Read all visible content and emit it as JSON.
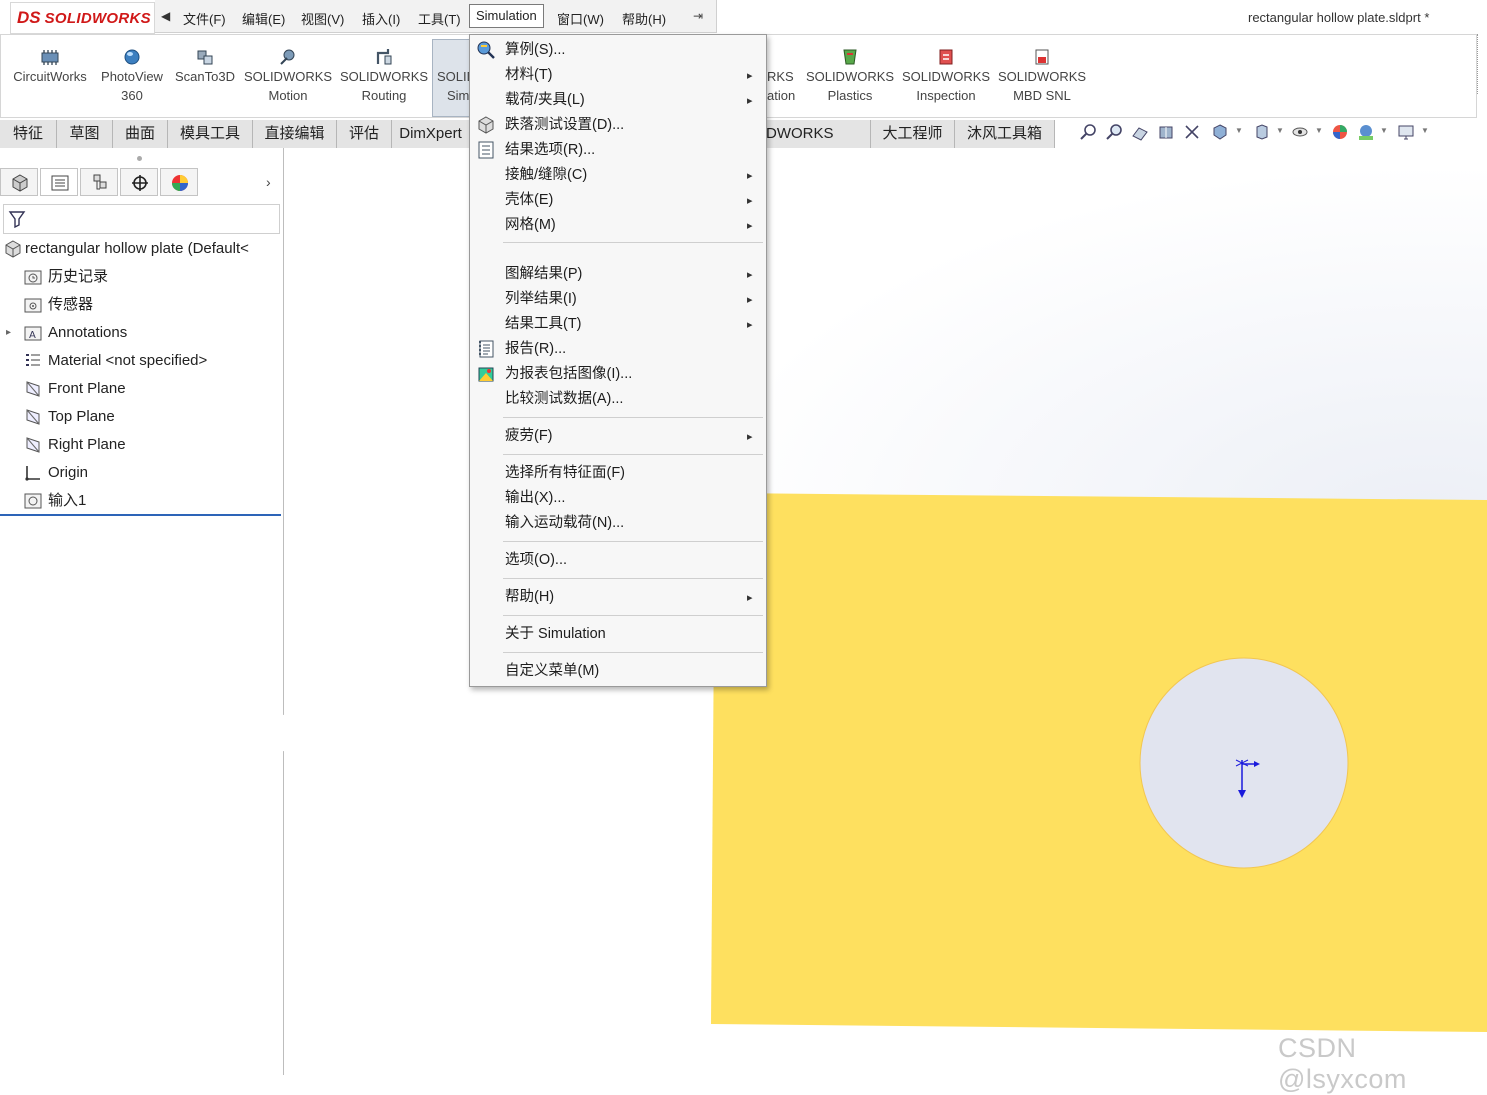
{
  "titlebar": {
    "logo_ds": "DS",
    "logo_text": "SOLIDWORKS",
    "menu": [
      "文件(F)",
      "编辑(E)",
      "视图(V)",
      "插入(I)",
      "工具(T)",
      "Simulation",
      "窗口(W)",
      "帮助(H)"
    ],
    "document_title": "rectangular hollow plate.sldprt *"
  },
  "command_manager": [
    {
      "line1": "CircuitWorks",
      "line2": "",
      "icon": "circuitworks-icon"
    },
    {
      "line1": "PhotoView",
      "line2": "360",
      "icon": "photoview-icon"
    },
    {
      "line1": "ScanTo3D",
      "line2": "",
      "icon": "scanto3d-icon"
    },
    {
      "line1": "SOLIDWORKS",
      "line2": "Motion",
      "icon": "motion-icon"
    },
    {
      "line1": "SOLIDWORKS",
      "line2": "Routing",
      "icon": "routing-icon"
    },
    {
      "line1": "SOLID",
      "line2": "Sim",
      "icon": "simulation-icon"
    },
    {
      "line1": "RKS",
      "line2": "ation",
      "icon": ""
    },
    {
      "line1": "SOLIDWORKS",
      "line2": "Plastics",
      "icon": "plastics-icon"
    },
    {
      "line1": "SOLIDWORKS",
      "line2": "Inspection",
      "icon": "inspection-icon"
    },
    {
      "line1": "SOLIDWORKS",
      "line2": "MBD SNL",
      "icon": "mbd-snl-icon"
    }
  ],
  "tabs": [
    "特征",
    "草图",
    "曲面",
    "模具工具",
    "直接编辑",
    "评估",
    "DimXpert",
    "DWORKS MBD",
    "大工程师",
    "沐风工具箱"
  ],
  "feature_tree": {
    "root": "rectangular hollow plate  (Default<",
    "items": [
      "历史记录",
      "传感器",
      "Annotations",
      "Material <not specified>",
      "Front Plane",
      "Top Plane",
      "Right Plane",
      "Origin",
      "输入1"
    ]
  },
  "simulation_menu": {
    "items": [
      {
        "label": "算例(S)...",
        "submenu": false
      },
      {
        "label": "材料(T)",
        "submenu": true
      },
      {
        "label": "载荷/夹具(L)",
        "submenu": true
      },
      {
        "label": "跌落测试设置(D)...",
        "submenu": false
      },
      {
        "label": "结果选项(R)...",
        "submenu": false
      },
      {
        "label": "接触/缝隙(C)",
        "submenu": true
      },
      {
        "label": "壳体(E)",
        "submenu": true
      },
      {
        "label": "网格(M)",
        "submenu": true
      },
      {
        "label": "图解结果(P)",
        "submenu": true
      },
      {
        "label": "列举结果(I)",
        "submenu": true
      },
      {
        "label": "结果工具(T)",
        "submenu": true
      },
      {
        "label": "报告(R)...",
        "submenu": false
      },
      {
        "label": "为报表包括图像(I)...",
        "submenu": false
      },
      {
        "label": "比较测试数据(A)...",
        "submenu": false
      },
      {
        "label": "疲劳(F)",
        "submenu": true
      },
      {
        "label": "选择所有特征面(F)",
        "submenu": false
      },
      {
        "label": "输出(X)...",
        "submenu": false
      },
      {
        "label": "输入运动载荷(N)...",
        "submenu": false
      },
      {
        "label": "选项(O)...",
        "submenu": false
      },
      {
        "label": "帮助(H)",
        "submenu": true
      },
      {
        "label": "关于 Simulation",
        "submenu": false
      },
      {
        "label": "自定义菜单(M)",
        "submenu": false
      }
    ]
  },
  "colors": {
    "plate": "#fee05f",
    "hole": "#e1e4ef",
    "accent_blue": "#2d64b8",
    "brand_red": "#d01818"
  },
  "watermark": "CSDN @lsyxcom"
}
